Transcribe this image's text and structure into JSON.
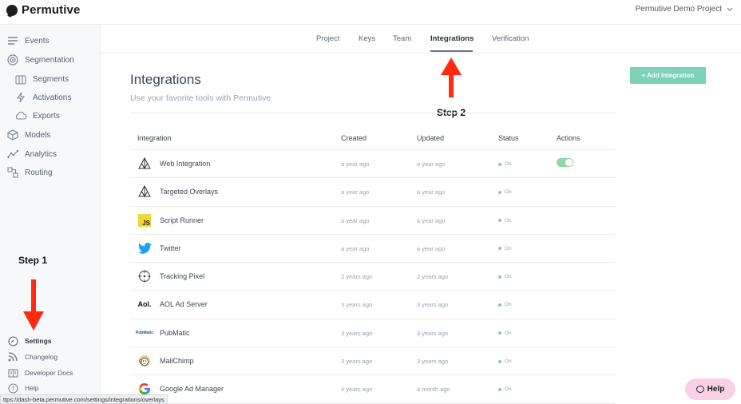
{
  "app": {
    "name": "Permutive",
    "project": "Permutive Demo Project"
  },
  "sidebar": {
    "items": [
      {
        "label": "Events",
        "icon": "list-icon"
      },
      {
        "label": "Segmentation",
        "icon": "target-icon"
      },
      {
        "label": "Segments",
        "icon": "segments-icon"
      },
      {
        "label": "Activations",
        "icon": "bolt-icon"
      },
      {
        "label": "Exports",
        "icon": "cloud-icon"
      },
      {
        "label": "Models",
        "icon": "cube-icon"
      },
      {
        "label": "Analytics",
        "icon": "analytics-icon"
      },
      {
        "label": "Routing",
        "icon": "routing-icon"
      }
    ],
    "footer": [
      {
        "label": "Settings",
        "icon": "gear-icon"
      },
      {
        "label": "Changelog",
        "icon": "rss-icon"
      },
      {
        "label": "Developer Docs",
        "icon": "book-icon"
      },
      {
        "label": "Help",
        "icon": "question-icon"
      }
    ],
    "step_label": "Step 1"
  },
  "tabs": [
    {
      "label": "Project"
    },
    {
      "label": "Keys"
    },
    {
      "label": "Team"
    },
    {
      "label": "Integrations",
      "active": true
    },
    {
      "label": "Verification"
    }
  ],
  "step2_label": "Step 2",
  "header": {
    "title": "Integrations",
    "subtitle": "Use your favorite tools with Permutive",
    "add_button": "+ Add Integration"
  },
  "table": {
    "columns": [
      "Integration",
      "Created",
      "Updated",
      "Status",
      "Actions"
    ],
    "rows": [
      {
        "name": "Web Integration",
        "created": "a year ago",
        "updated": "a year ago",
        "status": "On",
        "icon": "web-integration-icon",
        "toggle": true
      },
      {
        "name": "Targeted Overlays",
        "created": "a year ago",
        "updated": "a year ago",
        "status": "On",
        "icon": "overlays-icon"
      },
      {
        "name": "Script Runner",
        "created": "a year ago",
        "updated": "a year ago",
        "status": "On",
        "icon": "js-icon"
      },
      {
        "name": "Twitter",
        "created": "a year ago",
        "updated": "a year ago",
        "status": "On",
        "icon": "twitter-icon"
      },
      {
        "name": "Tracking Pixel",
        "created": "2 years ago",
        "updated": "2 years ago",
        "status": "On",
        "icon": "crosshair-icon"
      },
      {
        "name": "AOL Ad Server",
        "created": "3 years ago",
        "updated": "3 years ago",
        "status": "On",
        "icon": "aol-icon"
      },
      {
        "name": "PubMatic",
        "created": "3 years ago",
        "updated": "3 years ago",
        "status": "On",
        "icon": "pubmatic-icon"
      },
      {
        "name": "MailChimp",
        "created": "3 years ago",
        "updated": "3 years ago",
        "status": "On",
        "icon": "mailchimp-icon"
      },
      {
        "name": "Google Ad Manager",
        "created": "4 years ago",
        "updated": "a month ago",
        "status": "On",
        "icon": "google-icon"
      }
    ]
  },
  "help_button": "Help",
  "status_url": "ttps://dash-beta.permutive.com/settings/integrations/overlays",
  "colors": {
    "accent_green": "#7bd2b6",
    "status_on": "#7fd49a",
    "help_bg": "#f8d2e4",
    "arrow_red": "#ff2a10"
  }
}
